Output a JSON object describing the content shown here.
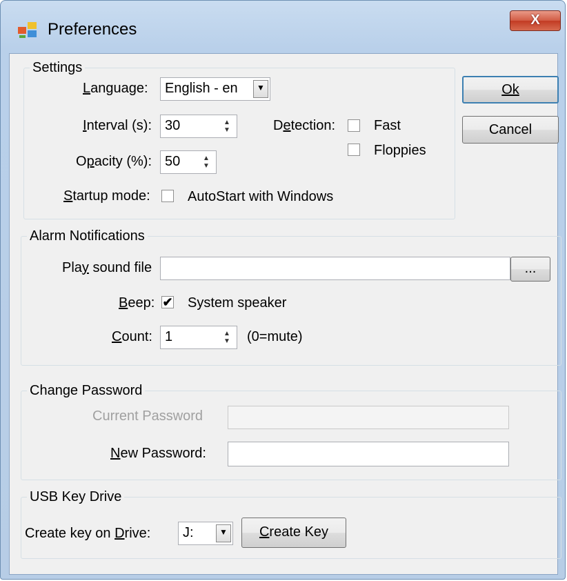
{
  "window": {
    "title": "Preferences",
    "close_label": "X"
  },
  "buttons": {
    "ok": "Ok",
    "cancel": "Cancel"
  },
  "settings": {
    "group_label": "Settings",
    "language_label": "Language:",
    "language_value": "English - en",
    "interval_label": "Interval (s):",
    "interval_value": "30",
    "detection_label": "Detection:",
    "fast_label": "Fast",
    "floppies_label": "Floppies",
    "opacity_label": "Opacity (%):",
    "opacity_value": "50",
    "startup_label": "Startup mode:",
    "autostart_label": "AutoStart with Windows",
    "fast_checked": false,
    "floppies_checked": false,
    "autostart_checked": false
  },
  "alarm": {
    "group_label": "Alarm Notifications",
    "sound_label": "Play sound file",
    "sound_value": "",
    "browse_label": "...",
    "beep_label": "Beep:",
    "speaker_label": "System speaker",
    "speaker_check": "✔",
    "count_label": "Count:",
    "count_value": "1",
    "mute_hint": "(0=mute)"
  },
  "password": {
    "group_label": "Change Password",
    "current_label": "Current Password",
    "new_label": "New Password:",
    "current_value": "",
    "new_value": ""
  },
  "usb": {
    "group_label": "USB Key Drive",
    "drive_label": "Create key on Drive:",
    "drive_value": "J:",
    "create_label": "Create Key"
  },
  "icons": {
    "dropdown": "▼",
    "spin_up": "▲",
    "spin_down": "▼"
  }
}
